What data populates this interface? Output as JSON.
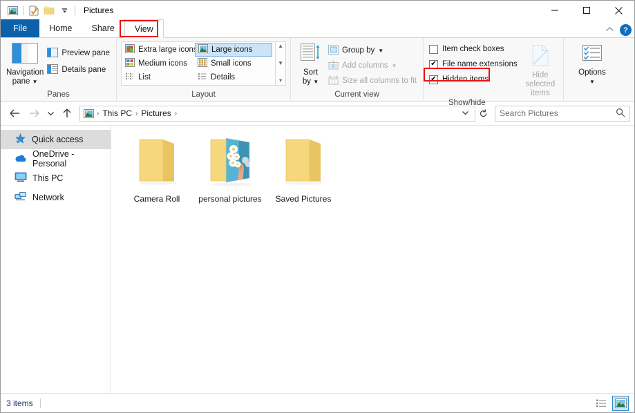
{
  "window": {
    "title": "Pictures",
    "quick_access_toolbar": [
      {
        "name": "explorer-icon",
        "label": "Properties of Pictures"
      },
      {
        "name": "properties-icon",
        "label": "Properties"
      },
      {
        "name": "new-folder-icon",
        "label": "New folder"
      },
      {
        "name": "customize-qat-chevron-icon",
        "label": "Customize Quick Access Toolbar"
      }
    ],
    "controls": {
      "minimize": "—",
      "maximize": "□",
      "close": "✕"
    }
  },
  "tabs": [
    {
      "label": "File",
      "active": false,
      "kind": "file"
    },
    {
      "label": "Home",
      "active": false,
      "kind": "normal"
    },
    {
      "label": "Share",
      "active": false,
      "kind": "normal"
    },
    {
      "label": "View",
      "active": true,
      "kind": "normal"
    }
  ],
  "ribbon_right": {
    "collapse_label": "⌃",
    "help_label": "?"
  },
  "ribbon": {
    "groups": [
      {
        "name": "panes",
        "label": "Panes",
        "big_button": {
          "label": "Navigation\npane",
          "icon": "navigation-pane-icon",
          "has_dropdown": true
        },
        "small_buttons": [
          {
            "label": "Preview pane",
            "icon": "preview-pane-icon",
            "disabled": false
          },
          {
            "label": "Details pane",
            "icon": "details-pane-icon",
            "disabled": false
          }
        ]
      },
      {
        "name": "layout",
        "label": "Layout",
        "items": [
          {
            "label": "Extra large icons",
            "icon": "extra-large-icons-icon",
            "selected": false
          },
          {
            "label": "Large icons",
            "icon": "large-icons-icon",
            "selected": true
          },
          {
            "label": "Medium icons",
            "icon": "medium-icons-icon",
            "selected": false
          },
          {
            "label": "Small icons",
            "icon": "small-icons-icon",
            "selected": false
          },
          {
            "label": "List",
            "icon": "list-view-icon",
            "selected": false
          },
          {
            "label": "Details",
            "icon": "details-view-icon",
            "selected": false
          }
        ],
        "scroll": {
          "up": "▲",
          "down": "▼",
          "more": "☰"
        }
      },
      {
        "name": "current-view",
        "label": "Current view",
        "big_button": {
          "label": "Sort\nby",
          "icon": "sort-by-icon",
          "has_dropdown": true
        },
        "small_buttons": [
          {
            "label": "Group by",
            "icon": "group-by-icon",
            "disabled": false,
            "has_dropdown": true
          },
          {
            "label": "Add columns",
            "icon": "add-columns-icon",
            "disabled": true,
            "has_dropdown": true
          },
          {
            "label": "Size all columns to fit",
            "icon": "size-columns-icon",
            "disabled": true,
            "has_dropdown": false
          }
        ]
      },
      {
        "name": "show-hide",
        "label": "Show/hide",
        "checkboxes": [
          {
            "label": "Item check boxes",
            "checked": false
          },
          {
            "label": "File name extensions",
            "checked": true
          },
          {
            "label": "Hidden items",
            "checked": true,
            "highlighted": true
          }
        ],
        "big_button": {
          "label": "Hide selected\nitems",
          "icon": "hide-selected-items-icon",
          "disabled": true
        }
      },
      {
        "name": "options",
        "label": "",
        "big_button": {
          "label": "Options",
          "icon": "options-icon",
          "has_dropdown": true
        }
      }
    ]
  },
  "address_bar": {
    "back": {
      "name": "back-arrow-icon",
      "glyph": "←",
      "enabled": true
    },
    "forward": {
      "name": "forward-arrow-icon",
      "glyph": "→",
      "enabled": false
    },
    "recent": {
      "name": "recent-locations-chevron-icon",
      "glyph": "∨"
    },
    "up": {
      "name": "up-one-level-icon",
      "glyph": "↑",
      "enabled": true
    },
    "breadcrumbs": [
      "This PC",
      "Pictures"
    ],
    "breadcrumb_separator": "›",
    "dropdown_glyph": "∨",
    "refresh_glyph": "↻",
    "search_placeholder": "Search Pictures",
    "search_value": "",
    "search_icon": "search-icon"
  },
  "nav_pane": {
    "items": [
      {
        "label": "Quick access",
        "icon": "quick-access-star-icon",
        "selected": true
      },
      {
        "label": "OneDrive - Personal",
        "icon": "onedrive-cloud-icon",
        "selected": false
      },
      {
        "label": "This PC",
        "icon": "this-pc-monitor-icon",
        "selected": false
      },
      {
        "label": "Network",
        "icon": "network-icon",
        "selected": false
      }
    ]
  },
  "content": {
    "items": [
      {
        "label": "Camera Roll",
        "icon": "folder-icon",
        "has_thumbnail": false
      },
      {
        "label": "personal pictures",
        "icon": "folder-with-picture-icon",
        "has_thumbnail": true
      },
      {
        "label": "Saved Pictures",
        "icon": "folder-icon",
        "has_thumbnail": false
      }
    ]
  },
  "status_bar": {
    "item_count": "3 items",
    "view_buttons": [
      {
        "name": "details-view-button",
        "selected": false
      },
      {
        "name": "large-icons-view-button",
        "selected": true
      }
    ]
  },
  "colors": {
    "accent": "#0d61a9",
    "selection": "#cce4f7",
    "selection_border": "#7eb4ea",
    "annotation": "#ee1111",
    "folder": "#f7d77c",
    "folder_dark": "#e7c45f",
    "thumbnail_bg": "#55b4d4"
  }
}
